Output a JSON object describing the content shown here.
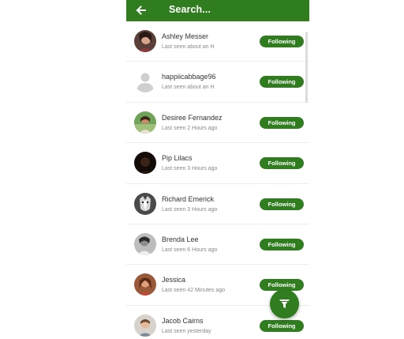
{
  "header": {
    "back_icon": "arrow-left-icon",
    "search_label": "Search...",
    "bar_color": "#2f7d1f"
  },
  "users": [
    {
      "name": "Ashley Messer",
      "last_seen": "Last seen about an H",
      "button": "Following",
      "avatar": "photo-dark-hair"
    },
    {
      "name": "happiicabbage96",
      "last_seen": "Last seen about an H",
      "button": "Following",
      "avatar": "default-person-icon"
    },
    {
      "name": "Desiree Fernandez",
      "last_seen": "Last seen 2 Hours ago",
      "button": "Following",
      "avatar": "photo-outdoor"
    },
    {
      "name": "Pip Lilacs",
      "last_seen": "Last seen 3 Hours ago",
      "button": "Following",
      "avatar": "photo-dark"
    },
    {
      "name": "Richard Emerick",
      "last_seen": "Last seen 3 Hours ago",
      "button": "Following",
      "avatar": "photo-dog"
    },
    {
      "name": "Brenda Lee",
      "last_seen": "Last seen 6 Hours ago",
      "button": "Following",
      "avatar": "photo-grayscale"
    },
    {
      "name": "Jessica",
      "last_seen": "Last seen 42 Minutes ago",
      "button": "Following",
      "avatar": "photo-warm"
    },
    {
      "name": "Jacob Cairns",
      "last_seen": "Last seen yesterday",
      "button": "Following",
      "avatar": "photo-light"
    }
  ],
  "fab": {
    "icon": "filter-icon"
  }
}
